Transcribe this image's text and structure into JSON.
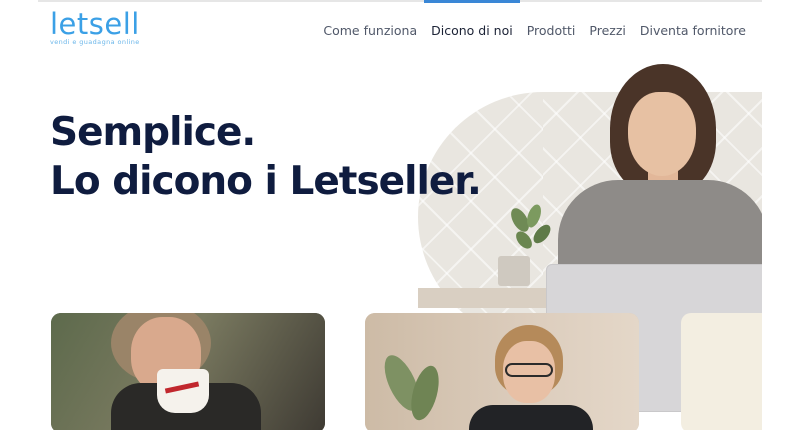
{
  "brand": {
    "name": "letsell",
    "tagline": "vendi e guadagna online",
    "color": "#3ba0e6"
  },
  "nav": {
    "items": [
      {
        "label": "Come funziona",
        "active": false
      },
      {
        "label": "Dicono di noi",
        "active": true
      },
      {
        "label": "Prodotti",
        "active": false
      },
      {
        "label": "Prezzi",
        "active": false
      },
      {
        "label": "Diventa fornitore",
        "active": false
      }
    ],
    "active_color": "#3a87d6"
  },
  "hero": {
    "line1": "Semplice.",
    "line2": "Lo dicono i Letseller.",
    "text_color": "#0f1c3f"
  }
}
